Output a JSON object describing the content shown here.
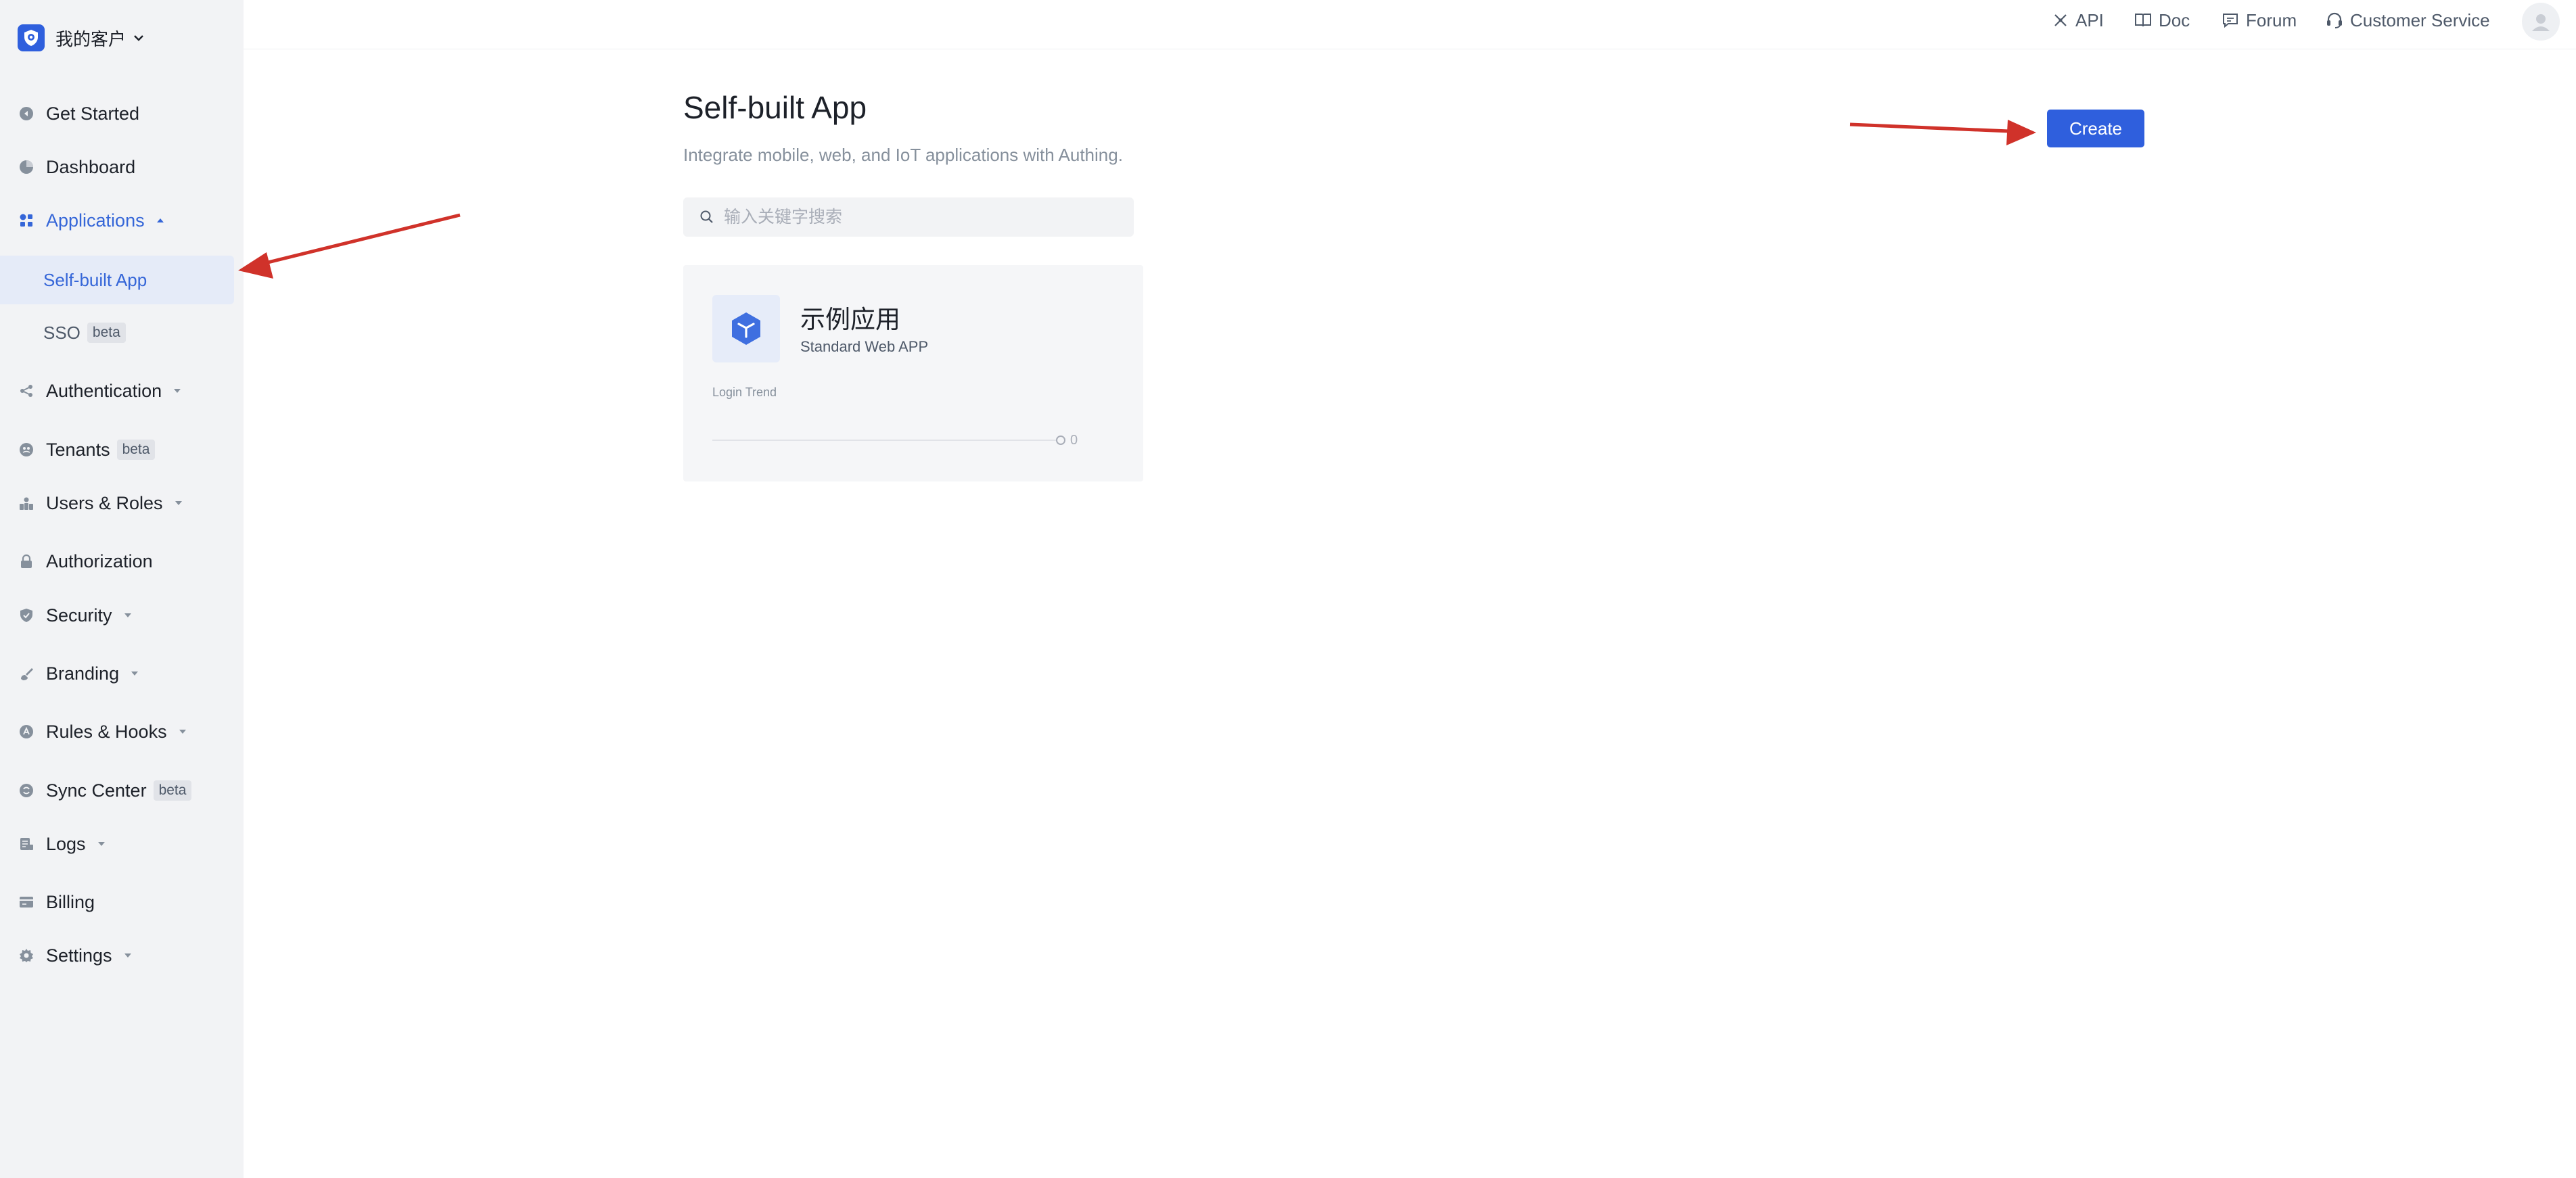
{
  "workspace": {
    "name": "我的客户"
  },
  "sidebar": {
    "items": [
      {
        "label": "Get Started"
      },
      {
        "label": "Dashboard"
      },
      {
        "label": "Applications"
      },
      {
        "label": "Self-built App"
      },
      {
        "label": "SSO",
        "badge": "beta"
      },
      {
        "label": "Authentication"
      },
      {
        "label": "Tenants",
        "badge": "beta"
      },
      {
        "label": "Users & Roles"
      },
      {
        "label": "Authorization"
      },
      {
        "label": "Security"
      },
      {
        "label": "Branding"
      },
      {
        "label": "Rules & Hooks"
      },
      {
        "label": "Sync Center",
        "badge": "beta"
      },
      {
        "label": "Logs"
      },
      {
        "label": "Billing"
      },
      {
        "label": "Settings"
      }
    ]
  },
  "topbar": {
    "links": [
      {
        "label": "API",
        "icon": "api-icon"
      },
      {
        "label": "Doc",
        "icon": "book-icon"
      },
      {
        "label": "Forum",
        "icon": "forum-icon"
      },
      {
        "label": "Customer Service",
        "icon": "headset-icon"
      }
    ]
  },
  "main": {
    "title": "Self-built App",
    "subtitle": "Integrate mobile, web, and IoT applications with Authing.",
    "search_placeholder": "输入关键字搜索",
    "create_label": "Create",
    "apps": [
      {
        "name": "示例应用",
        "type": "Standard Web APP",
        "trend_label": "Login Trend",
        "trend_value": "0"
      }
    ]
  },
  "colors": {
    "primary": "#2f5fdd",
    "sidebar_bg": "#f2f3f5",
    "active_text": "#3566d8",
    "annotation_arrow": "#d0322a"
  }
}
